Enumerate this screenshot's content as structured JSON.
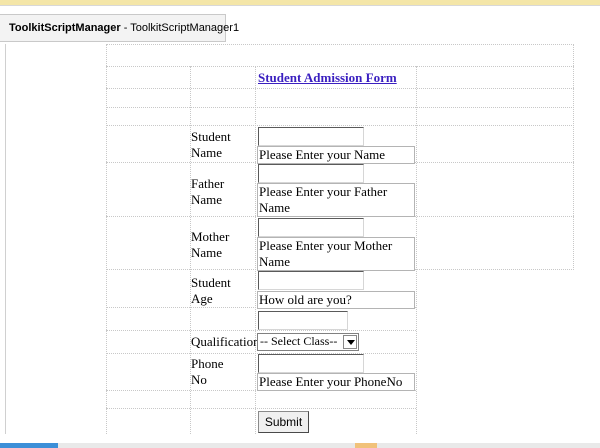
{
  "tab": {
    "control": "ToolkitScriptManager",
    "separator": " - ",
    "id": "ToolkitScriptManager1"
  },
  "form": {
    "title": "Student Admission Form",
    "student_name": {
      "label_line1": "Student",
      "label_line2": "Name",
      "hint": "Please Enter your Name"
    },
    "father_name": {
      "label_line1": "Father",
      "label_line2": "Name",
      "hint": "Please Enter your Father Name"
    },
    "mother_name": {
      "label_line1": "Mother",
      "label_line2": "Name",
      "hint": "Please Enter your Mother Name"
    },
    "student_age": {
      "label_line1": "Student",
      "label_line2": "Age",
      "hint": "How old are you?"
    },
    "qualification": {
      "label": "Qualification",
      "selected": "-- Select Class--"
    },
    "phone": {
      "label_line1": "Phone",
      "label_line2": "No",
      "hint": "Please Enter your PhoneNo"
    },
    "submit_label": "Submit"
  },
  "colors": {
    "title": "#3a1fc0",
    "grid_lines": "#c8c8c8",
    "top_accent": "#f4e6a8"
  }
}
